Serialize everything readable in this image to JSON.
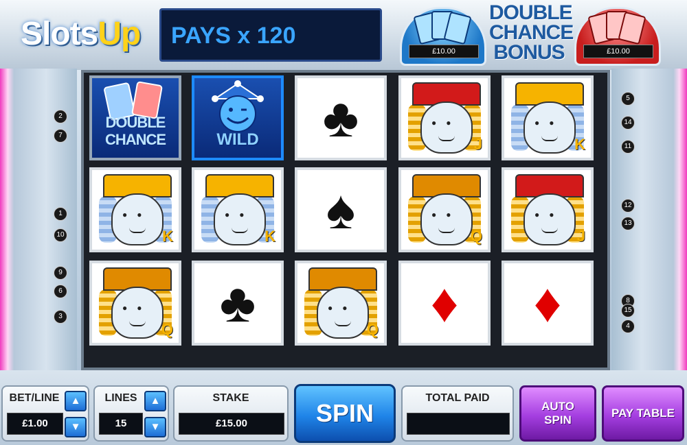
{
  "header": {
    "logo_main": "Slots",
    "logo_accent": "Up",
    "pays_text": "PAYS x 120",
    "bonus_title_lines": [
      "DOUBLE",
      "CHANCE",
      "BONUS"
    ],
    "bonus_blue_value": "£10.00",
    "bonus_red_value": "£10.00"
  },
  "paylines": {
    "left": [
      "2",
      "7",
      "1",
      "10",
      "9",
      "6",
      "3"
    ],
    "right": [
      "5",
      "14",
      "11",
      "12",
      "13",
      "8",
      "15",
      "4"
    ]
  },
  "reels": [
    [
      {
        "type": "double-chance",
        "label_1": "DOUBLE",
        "label_2": "CHANCE"
      },
      {
        "type": "wild",
        "label": "WILD"
      },
      {
        "type": "suit",
        "glyph": "♣",
        "color": "#111111"
      },
      {
        "type": "jack",
        "rank": "J"
      },
      {
        "type": "king",
        "rank": "K"
      }
    ],
    [
      {
        "type": "king",
        "rank": "K"
      },
      {
        "type": "king",
        "rank": "K"
      },
      {
        "type": "suit",
        "glyph": "♠",
        "color": "#111111"
      },
      {
        "type": "queen",
        "rank": "Q"
      },
      {
        "type": "jack",
        "rank": "J"
      }
    ],
    [
      {
        "type": "queen",
        "rank": "Q"
      },
      {
        "type": "suit",
        "glyph": "♣",
        "color": "#111111"
      },
      {
        "type": "queen",
        "rank": "Q"
      },
      {
        "type": "suit",
        "glyph": "♦",
        "color": "#e00000"
      },
      {
        "type": "suit",
        "glyph": "♦",
        "color": "#e00000"
      }
    ]
  ],
  "controls": {
    "bet_line_label": "BET/LINE",
    "bet_line_value": "£1.00",
    "lines_label": "LINES",
    "lines_value": "15",
    "stake_label": "STAKE",
    "stake_value": "£15.00",
    "spin_label": "SPIN",
    "total_paid_label": "TOTAL PAID",
    "total_paid_value": "",
    "auto_spin_lines": [
      "AUTO",
      "SPIN"
    ],
    "pay_table_label": "PAY TABLE",
    "up_arrow": "▲",
    "down_arrow": "▼"
  },
  "colors": {
    "accent_blue": "#1f84e8",
    "accent_purple": "#a43ee0",
    "accent_pink": "#f03bbf"
  }
}
